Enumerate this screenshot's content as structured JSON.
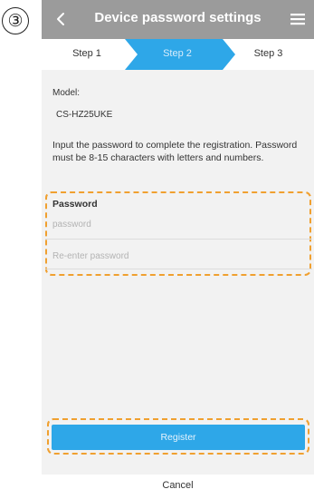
{
  "annotation": {
    "step_number": "③"
  },
  "header": {
    "title": "Device password settings",
    "back_icon": "chevron-left-icon",
    "menu_icon": "hamburger-menu-icon"
  },
  "steps": {
    "items": [
      {
        "label": "Step 1",
        "active": false
      },
      {
        "label": "Step 2",
        "active": true
      },
      {
        "label": "Step 3",
        "active": false
      }
    ]
  },
  "model": {
    "label": "Model:",
    "value": "CS-HZ25UKE"
  },
  "instructions": "Input the password to complete the registration. Password must be 8-15 characters with letters and numbers.",
  "password": {
    "title": "Password",
    "field1_placeholder": "password",
    "field2_placeholder": "Re-enter password"
  },
  "actions": {
    "register_label": "Register",
    "cancel_label": "Cancel"
  },
  "colors": {
    "header_bg": "#9b9b9b",
    "active_step": "#2ea7e8",
    "register_button": "#2ea7e8",
    "highlight_dash": "#f0a030"
  }
}
